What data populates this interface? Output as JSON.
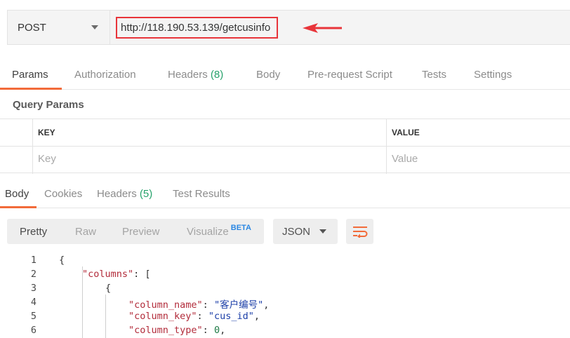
{
  "request": {
    "method": "POST",
    "url": "http://118.190.53.139/getcusinfo"
  },
  "request_tabs": [
    {
      "label": "Params",
      "count": "",
      "active": true
    },
    {
      "label": "Authorization",
      "count": ""
    },
    {
      "label": "Headers",
      "count": "(8)"
    },
    {
      "label": "Body",
      "count": ""
    },
    {
      "label": "Pre-request Script",
      "count": ""
    },
    {
      "label": "Tests",
      "count": ""
    },
    {
      "label": "Settings",
      "count": ""
    }
  ],
  "query_params": {
    "title": "Query Params",
    "key_header": "KEY",
    "value_header": "VALUE",
    "key_placeholder": "Key",
    "value_placeholder": "Value"
  },
  "response_tabs": [
    {
      "label": "Body",
      "count": "",
      "active": true
    },
    {
      "label": "Cookies",
      "count": ""
    },
    {
      "label": "Headers",
      "count": "(5)"
    },
    {
      "label": "Test Results",
      "count": ""
    }
  ],
  "response_view": {
    "modes": [
      "Pretty",
      "Raw",
      "Preview",
      "Visualize"
    ],
    "beta_badge": "BETA",
    "format": "JSON"
  },
  "code_lines": [
    {
      "no": "1",
      "key": "",
      "value": "",
      "text": "{"
    },
    {
      "no": "2",
      "key": "\"columns\"",
      "value": "",
      "text": ": ["
    },
    {
      "no": "3",
      "key": "",
      "value": "",
      "text": "{"
    },
    {
      "no": "4",
      "key": "\"column_name\"",
      "value": "\"客户编号\"",
      "text": ","
    },
    {
      "no": "5",
      "key": "\"column_key\"",
      "value": "\"cus_id\"",
      "text": ","
    },
    {
      "no": "6",
      "key": "\"column_type\"",
      "value": "0",
      "text": ","
    }
  ],
  "colors": {
    "accent_orange": "#f26b3a",
    "url_highlight_red": "#e8343a",
    "count_green": "#26a26b",
    "beta_blue": "#2b87e3",
    "json_key": "#b22b3a",
    "json_string": "#1c3fa8",
    "json_number": "#1c7a45"
  },
  "icons": {
    "method_dropdown": "chevron-down-icon",
    "format_dropdown": "chevron-down-icon",
    "wrap_lines": "wrap-lines-icon",
    "annotation": "red-arrow-icon"
  }
}
